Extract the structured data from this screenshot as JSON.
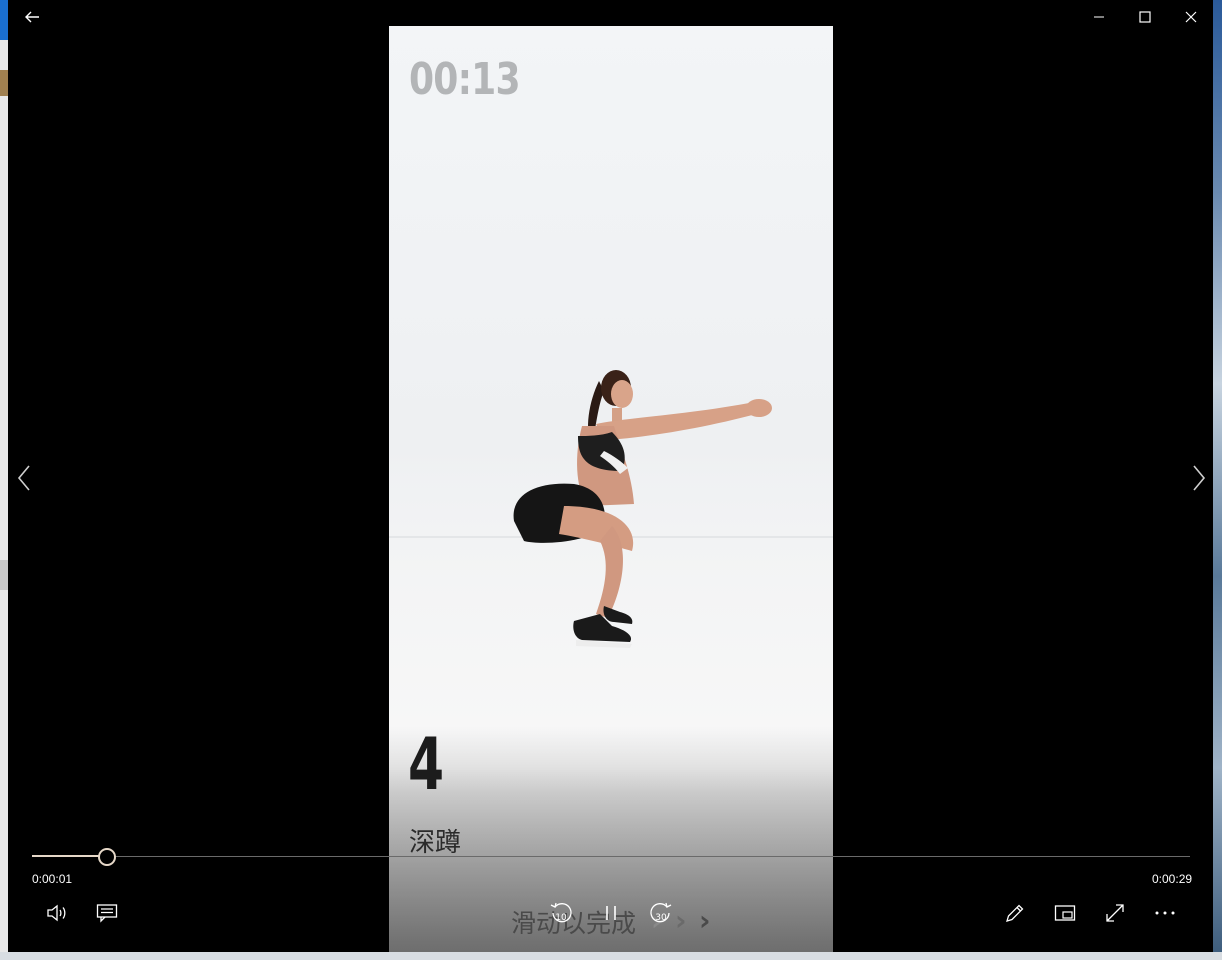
{
  "video_overlay": {
    "timer": "00:13",
    "exercise_number": "4",
    "exercise_name": "深蹲",
    "swipe_hint": "滑动以完成"
  },
  "player": {
    "current_time": "0:00:01",
    "duration": "0:00:29",
    "progress_fraction": 0.065,
    "skip_back_seconds": "10",
    "skip_forward_seconds": "30"
  },
  "colors": {
    "accent": "#e6d8c8",
    "player_bg": "#000000",
    "video_bg": "#f2f4f6"
  },
  "icons": {
    "back": "back-arrow-icon",
    "minimize": "minimize-icon",
    "maximize": "maximize-icon",
    "close": "close-icon",
    "volume": "volume-icon",
    "captions": "captions-icon",
    "edit": "pencil-icon",
    "miniview": "mini-view-icon",
    "fullscreen": "fullscreen-icon",
    "more": "more-icon",
    "previous": "chevron-left-icon",
    "next": "chevron-right-icon"
  }
}
